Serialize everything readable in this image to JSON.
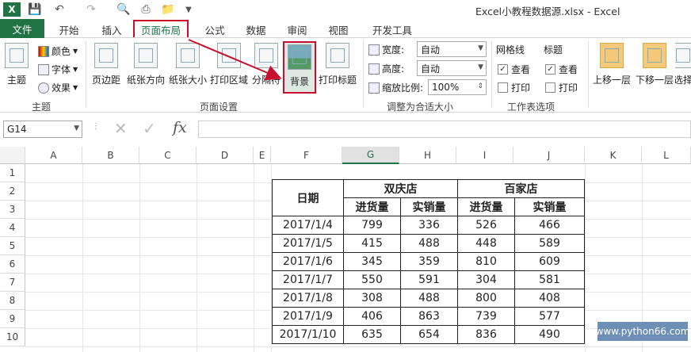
{
  "window_title": "Excel小教程数据源.xlsx - Excel",
  "quick_access": {
    "icons": [
      "excel-logo-icon",
      "save-icon",
      "undo-icon",
      "redo-icon",
      "print-preview-icon",
      "quick-print-icon",
      "open-icon",
      "customize-icon"
    ]
  },
  "tabs": [
    "文件",
    "开始",
    "插入",
    "页面布局",
    "公式",
    "数据",
    "审阅",
    "视图",
    "开发工具"
  ],
  "active_tab": "页面布局",
  "ribbon": {
    "themes": {
      "main": "主题",
      "colors": "颜色",
      "fonts": "字体",
      "effects": "效果",
      "group": "主题"
    },
    "page_setup": {
      "margins": "页边距",
      "orientation": "纸张方向",
      "size": "纸张大小",
      "print_area": "打印区域",
      "breaks": "分隔符",
      "background": "背景",
      "print_titles": "打印标题",
      "group": "页面设置"
    },
    "scale": {
      "width_label": "宽度:",
      "width_value": "自动",
      "height_label": "高度:",
      "height_value": "自动",
      "scale_label": "缩放比例:",
      "scale_value": "100%",
      "group": "调整为合适大小"
    },
    "sheet_options": {
      "gridlines": "网格线",
      "headings": "标题",
      "view": "查看",
      "print": "打印",
      "group": "工作表选项"
    },
    "arrange": {
      "bring_forward": "上移一层",
      "send_backward": "下移一层",
      "selection": "选择"
    }
  },
  "formula_bar": {
    "name_box": "G14",
    "fx": "fx",
    "formula": ""
  },
  "columns": [
    "A",
    "B",
    "C",
    "D",
    "E",
    "F",
    "G",
    "H",
    "I",
    "J",
    "K",
    "L"
  ],
  "rows": [
    "1",
    "2",
    "3",
    "4",
    "5",
    "6",
    "7",
    "8",
    "9",
    "10"
  ],
  "table": {
    "date_header": "日期",
    "store1": "双庆店",
    "store2": "百家店",
    "sub_headers": [
      "进货量",
      "实销量",
      "进货量",
      "实销量"
    ],
    "records": [
      [
        "2017/1/4",
        "799",
        "336",
        "526",
        "466"
      ],
      [
        "2017/1/5",
        "415",
        "488",
        "448",
        "589"
      ],
      [
        "2017/1/6",
        "345",
        "359",
        "810",
        "609"
      ],
      [
        "2017/1/7",
        "550",
        "591",
        "304",
        "581"
      ],
      [
        "2017/1/8",
        "308",
        "488",
        "800",
        "408"
      ],
      [
        "2017/1/9",
        "406",
        "863",
        "739",
        "577"
      ],
      [
        "2017/1/10",
        "635",
        "654",
        "836",
        "490"
      ]
    ]
  },
  "watermark": "www.python66.com",
  "colors": {
    "excel_green": "#217346",
    "highlight_red": "#c8102e"
  }
}
